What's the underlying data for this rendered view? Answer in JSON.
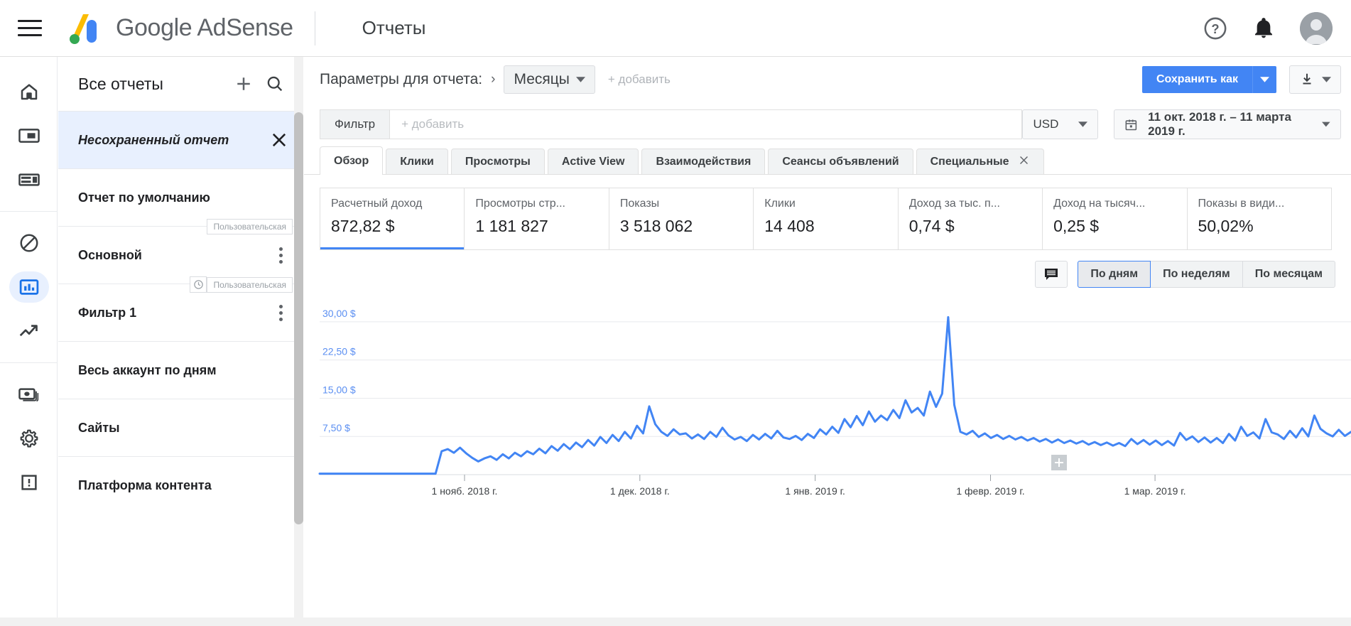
{
  "topbar": {
    "menu_icon": "hamburger-menu-icon",
    "brand": "Google AdSense",
    "page_title": "Отчеты",
    "help_icon": "help-icon",
    "notifications_icon": "bell-icon",
    "account_icon": "avatar"
  },
  "rail": {
    "items": [
      {
        "icon": "home-icon",
        "name": "home",
        "active": false
      },
      {
        "icon": "ads-icon",
        "name": "ads",
        "active": false
      },
      {
        "icon": "layout-icon",
        "name": "sites-layout",
        "active": false
      },
      {
        "icon": "block-icon",
        "name": "blocking-controls",
        "active": false
      },
      {
        "icon": "bar-chart-icon",
        "name": "reports",
        "active": true
      },
      {
        "icon": "trending-up-icon",
        "name": "optimization",
        "active": false
      },
      {
        "icon": "money-icon",
        "name": "payments",
        "active": false
      },
      {
        "icon": "gear-icon",
        "name": "settings",
        "active": false
      },
      {
        "icon": "feedback-icon",
        "name": "feedback",
        "active": false
      }
    ]
  },
  "reports_panel": {
    "title": "Все отчеты",
    "add_icon": "plus-icon",
    "search_icon": "search-icon",
    "items": [
      {
        "name": "Несохраненный отчет",
        "selected": true,
        "italic": true,
        "action": "close",
        "badges": []
      },
      {
        "name": "Отчет по умолчанию",
        "selected": false,
        "italic": false,
        "action": "none",
        "badges": []
      },
      {
        "name": "Основной",
        "selected": false,
        "italic": false,
        "action": "menu",
        "badges": [
          {
            "type": "text",
            "label": "Пользовательская"
          }
        ]
      },
      {
        "name": "Фильтр 1",
        "selected": false,
        "italic": false,
        "action": "menu",
        "badges": [
          {
            "type": "clock",
            "label": ""
          },
          {
            "type": "text",
            "label": "Пользовательская"
          }
        ]
      },
      {
        "name": "Весь аккаунт по дням",
        "selected": false,
        "italic": false,
        "action": "none",
        "badges": []
      },
      {
        "name": "Сайты",
        "selected": false,
        "italic": false,
        "action": "none",
        "badges": []
      },
      {
        "name": "Платформа контента",
        "selected": false,
        "italic": false,
        "action": "none",
        "badges": []
      }
    ]
  },
  "params": {
    "label": "Параметры для отчета:",
    "chevron": "›",
    "dimension": "Месяцы",
    "add_label": "+ добавить",
    "save_as": "Сохранить как",
    "save_as_arrow_icon": "chevron-down-icon",
    "download_icon": "download-icon",
    "download_arrow_icon": "chevron-down-icon"
  },
  "filter": {
    "tag": "Фильтр",
    "placeholder": "+ добавить",
    "currency": "USD",
    "currency_arrow_icon": "chevron-down-icon",
    "calendar_icon": "calendar-icon",
    "date_range": "11 окт. 2018 г. – 11 марта 2019 г.",
    "date_arrow_icon": "chevron-down-icon"
  },
  "tabs": [
    {
      "label": "Обзор",
      "active": true,
      "closable": false
    },
    {
      "label": "Клики",
      "active": false,
      "closable": false
    },
    {
      "label": "Просмотры",
      "active": false,
      "closable": false
    },
    {
      "label": "Active View",
      "active": false,
      "closable": false
    },
    {
      "label": "Взаимодействия",
      "active": false,
      "closable": false
    },
    {
      "label": "Сеансы объявлений",
      "active": false,
      "closable": false
    },
    {
      "label": "Специальные",
      "active": false,
      "closable": true
    }
  ],
  "metrics": [
    {
      "label": "Расчетный доход",
      "value": "872,82 $",
      "active": true
    },
    {
      "label": "Просмотры стр...",
      "value": "1 181 827",
      "active": false
    },
    {
      "label": "Показы",
      "value": "3 518 062",
      "active": false
    },
    {
      "label": "Клики",
      "value": "14 408",
      "active": false
    },
    {
      "label": "Доход за тыс. п...",
      "value": "0,74 $",
      "active": false
    },
    {
      "label": "Доход на тысяч...",
      "value": "0,25 $",
      "active": false
    },
    {
      "label": "Показы в види...",
      "value": "50,02%",
      "active": false
    }
  ],
  "granularity": {
    "annotation_icon": "comment-icon",
    "options": [
      {
        "label": "По дням",
        "active": true
      },
      {
        "label": "По неделям",
        "active": false
      },
      {
        "label": "По месяцам",
        "active": false
      }
    ]
  },
  "chart_data": {
    "type": "line",
    "title": "",
    "xlabel": "",
    "ylabel": "",
    "series_name": "Расчетный доход",
    "line_color": "#4285f4",
    "grid": true,
    "ylim": [
      0,
      33.75
    ],
    "y_ticks": [
      7.5,
      15,
      22.5,
      30
    ],
    "y_tick_labels": [
      "7,50 $",
      "15,00 $",
      "22,50 $",
      "30,00 $"
    ],
    "x_tick_labels": [
      "1 нояб. 2018 г.",
      "1 дек. 2018 г.",
      "1 янв. 2019 г.",
      "1 февр. 2019 г.",
      "1 мар. 2019 г."
    ],
    "x_tick_positions": [
      0.0785,
      0.2485,
      0.4185,
      0.5885,
      0.748
    ],
    "x_start": "11 окт. 2018 г.",
    "x_end": "11 марта 2019 г.",
    "values": [
      0.2,
      0.2,
      0.2,
      0.2,
      0.2,
      0.2,
      0.2,
      0.2,
      0.2,
      0.2,
      0.2,
      0.2,
      0.2,
      0.2,
      0.2,
      0.2,
      0.2,
      0.2,
      0.2,
      0.2,
      4.6,
      5.0,
      4.3,
      5.3,
      4.2,
      3.3,
      2.6,
      3.2,
      3.6,
      2.9,
      4.0,
      3.2,
      4.3,
      3.6,
      4.6,
      4.0,
      5.1,
      4.2,
      5.6,
      4.7,
      6.0,
      5.0,
      6.3,
      5.4,
      6.8,
      5.7,
      7.4,
      6.2,
      7.8,
      6.6,
      8.4,
      7.1,
      9.6,
      8.1,
      13.4,
      9.9,
      8.4,
      7.6,
      8.9,
      7.9,
      8.1,
      7.1,
      7.9,
      7.0,
      8.4,
      7.4,
      9.2,
      7.7,
      6.9,
      7.4,
      6.6,
      7.8,
      6.9,
      8.0,
      7.1,
      8.6,
      7.3,
      7.0,
      7.6,
      6.8,
      8.0,
      7.2,
      8.9,
      7.9,
      9.4,
      8.2,
      10.9,
      9.3,
      11.5,
      9.7,
      12.4,
      10.4,
      11.6,
      10.7,
      12.7,
      11.1,
      14.6,
      12.2,
      13.1,
      11.6,
      16.3,
      13.3,
      15.9,
      30.9,
      13.7,
      8.4,
      7.9,
      8.6,
      7.4,
      8.1,
      7.2,
      7.8,
      7.0,
      7.6,
      6.9,
      7.4,
      6.7,
      7.2,
      6.5,
      7.0,
      6.3,
      6.9,
      6.2,
      6.7,
      6.1,
      6.6,
      5.9,
      6.4,
      5.8,
      6.3,
      5.7,
      6.2,
      5.6,
      7.0,
      6.0,
      6.8,
      5.9,
      6.7,
      5.8,
      6.6,
      5.7,
      8.2,
      6.8,
      7.5,
      6.4,
      7.3,
      6.3,
      7.2,
      6.2,
      8.0,
      6.7,
      9.4,
      7.6,
      8.3,
      7.1,
      10.9,
      8.3,
      7.9,
      7.0,
      8.6,
      7.3,
      9.1,
      7.5,
      11.6,
      9.0,
      8.1,
      7.5,
      8.8,
      7.6,
      8.4
    ]
  }
}
